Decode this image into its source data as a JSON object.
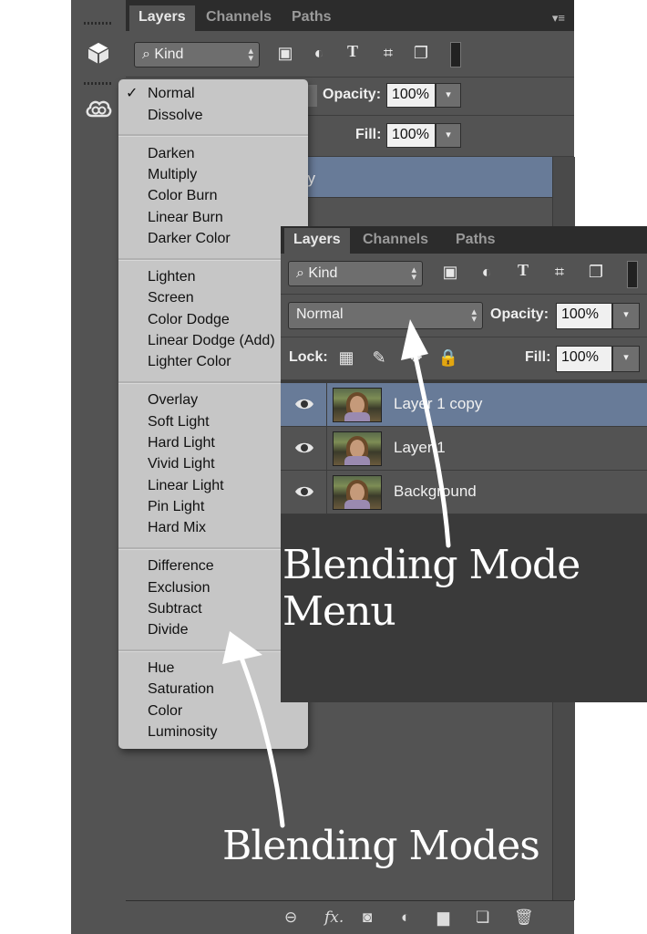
{
  "back_panel": {
    "tabs": [
      "Layers",
      "Channels",
      "Paths"
    ],
    "filter_label": "Kind",
    "opacity_label": "Opacity:",
    "opacity_value": "100%",
    "fill_label": "Fill:",
    "fill_value": "100%",
    "selected_layer_partial": "py"
  },
  "blend_menu": {
    "selected": "Normal",
    "groups": [
      [
        "Normal",
        "Dissolve"
      ],
      [
        "Darken",
        "Multiply",
        "Color Burn",
        "Linear Burn",
        "Darker Color"
      ],
      [
        "Lighten",
        "Screen",
        "Color Dodge",
        "Linear Dodge (Add)",
        "Lighter Color"
      ],
      [
        "Overlay",
        "Soft Light",
        "Hard Light",
        "Vivid Light",
        "Linear Light",
        "Pin Light",
        "Hard Mix"
      ],
      [
        "Difference",
        "Exclusion",
        "Subtract",
        "Divide"
      ],
      [
        "Hue",
        "Saturation",
        "Color",
        "Luminosity"
      ]
    ]
  },
  "front_panel": {
    "tabs": [
      "Layers",
      "Channels",
      "Paths"
    ],
    "filter_label": "Kind",
    "blend_mode": "Normal",
    "opacity_label": "Opacity:",
    "opacity_value": "100%",
    "lock_label": "Lock:",
    "fill_label": "Fill:",
    "fill_value": "100%",
    "layers": [
      {
        "name": "Layer 1 copy",
        "selected": true
      },
      {
        "name": "Layer 1",
        "selected": false
      },
      {
        "name": "Background",
        "selected": false
      }
    ]
  },
  "annotations": {
    "menu": "Blending Mode Menu",
    "modes": "Blending Modes"
  },
  "colors": {
    "panel": "#535353",
    "panel_dark": "#3a3a3a",
    "selected_row": "#687b98",
    "menu_bg": "#c6c6c6"
  }
}
